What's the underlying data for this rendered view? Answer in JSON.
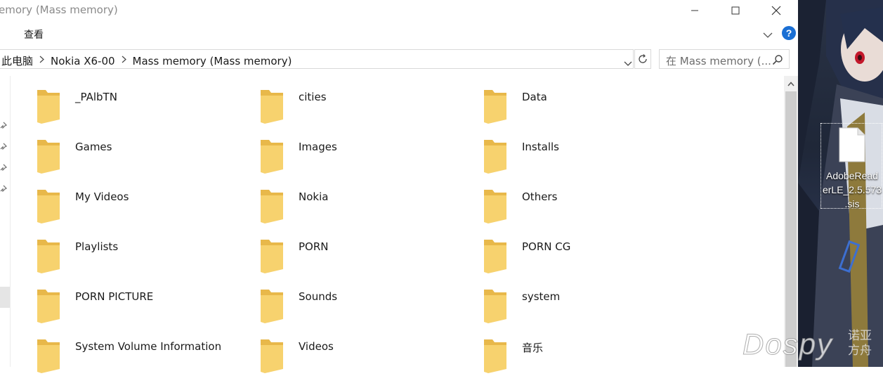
{
  "window": {
    "title": "emory (Mass memory)"
  },
  "ribbon": {
    "tab_view": "查看"
  },
  "help": {
    "label": "?"
  },
  "address": {
    "crumbs": [
      "此电脑",
      "Nokia X6-00",
      "Mass memory (Mass memory)"
    ]
  },
  "search": {
    "placeholder": "在 Mass memory (..."
  },
  "folders": [
    {
      "name": "_PAlbTN"
    },
    {
      "name": "cities"
    },
    {
      "name": "Data"
    },
    {
      "name": "Games"
    },
    {
      "name": "Images"
    },
    {
      "name": "Installs"
    },
    {
      "name": "My Videos"
    },
    {
      "name": "Nokia"
    },
    {
      "name": "Others"
    },
    {
      "name": "Playlists"
    },
    {
      "name": "PORN"
    },
    {
      "name": "PORN CG"
    },
    {
      "name": "PORN PICTURE"
    },
    {
      "name": "Sounds"
    },
    {
      "name": "system"
    },
    {
      "name": "System Volume Information"
    },
    {
      "name": "Videos"
    },
    {
      "name": "音乐"
    }
  ],
  "desktop": {
    "file_label_lines": [
      "AdobeRead",
      "erLE_2.5.573",
      ".sis"
    ]
  },
  "watermark": {
    "logo": "Dospy",
    "subtitle_lines": [
      "诺亚",
      "方舟"
    ]
  },
  "colors": {
    "folder_yellow": "#f7d26e",
    "folder_back": "#e8b84a",
    "accent_blue": "#1a6fd4"
  }
}
